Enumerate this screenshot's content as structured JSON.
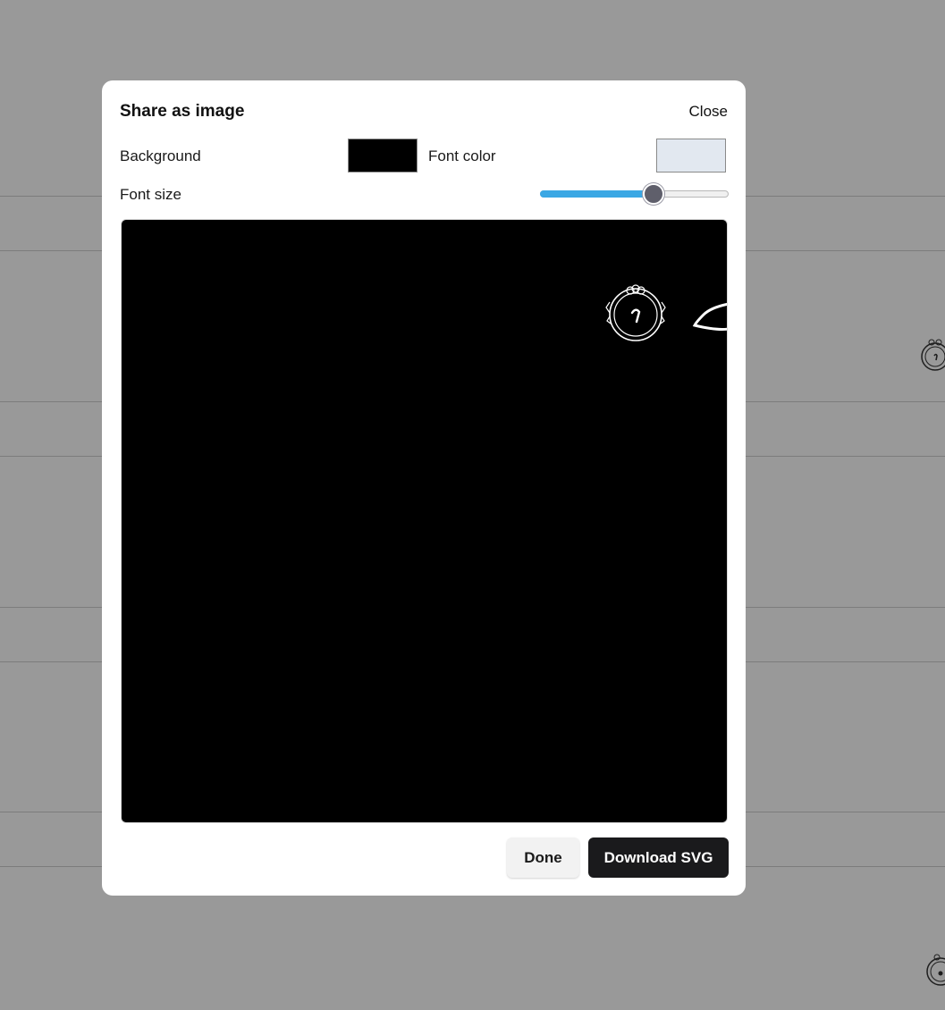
{
  "dialog": {
    "title": "Share as image",
    "close_label": "Close",
    "background_label": "Background",
    "background_color": "#000000",
    "font_color_label": "Font color",
    "font_color": "#e2e8f0",
    "font_size_label": "Font size",
    "font_size_level": 0.6,
    "done_label": "Done",
    "download_label": "Download SVG"
  },
  "colors": {
    "accent": "#3aa7e4",
    "primary_button": "#1a1a1c",
    "overlay": "rgba(0,0,0,0.40)"
  },
  "icons": [
    "quran-verse-end-medallion-icon",
    "text-stroke-fragment"
  ]
}
